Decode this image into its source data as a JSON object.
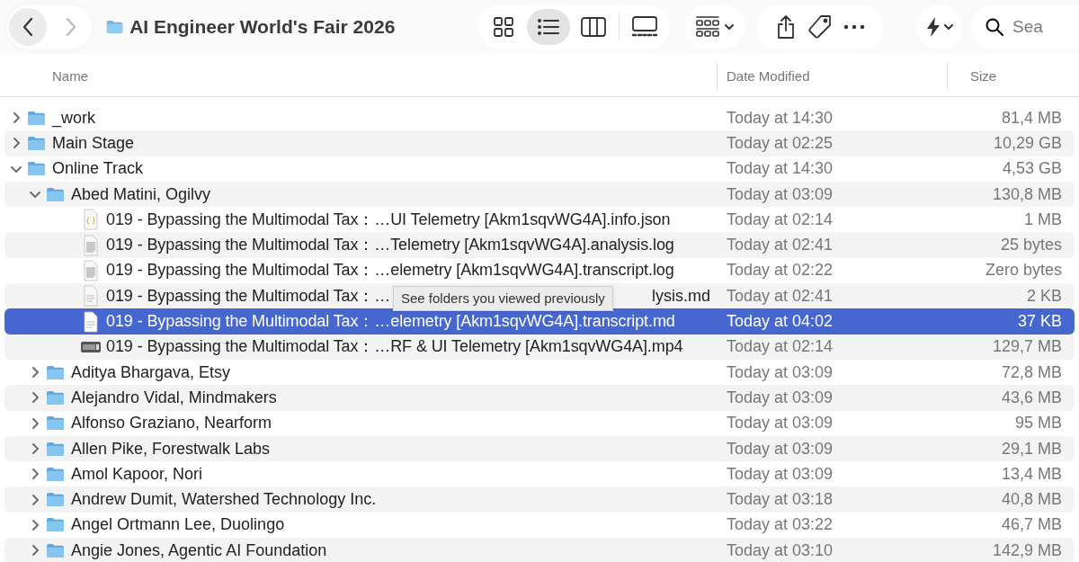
{
  "toolbar": {
    "title": "AI Engineer World's Fair 2026",
    "back_disabled": false,
    "forward_disabled": true,
    "views": [
      {
        "kind": "icons",
        "selected": false
      },
      {
        "kind": "list",
        "selected": true
      },
      {
        "kind": "columns",
        "selected": false
      },
      {
        "kind": "gallery",
        "selected": false
      }
    ],
    "search": {
      "placeholder": "Sea"
    }
  },
  "columns": [
    "Name",
    "Date Modified",
    "Size"
  ],
  "rows": [
    {
      "kind": "folder",
      "name": "_work",
      "date": "Today at 14:30",
      "size": "81,4 MB",
      "expanded": false,
      "selected": false
    },
    {
      "kind": "folder",
      "name": "Main Stage",
      "date": "Today at 02:25",
      "size": "10,29 GB",
      "expanded": false,
      "selected": false
    },
    {
      "kind": "folder",
      "name": "Online Track",
      "date": "Today at 14:30",
      "size": "4,53 GB",
      "expanded": true,
      "selected": false,
      "children": [
        {
          "kind": "folder",
          "name": "Abed Matini, Ogilvy",
          "date": "Today at 03:09",
          "size": "130,8 MB",
          "expanded": true,
          "selected": false,
          "children": [
            {
              "kind": "code",
              "name": "019 - Bypassing the Multimodal Tax：…UI Telemetry [Akm1sqvWG4A].info.json",
              "date": "Today at 02:14",
              "size": "1 MB",
              "selected": false
            },
            {
              "kind": "text",
              "name": "019 - Bypassing the Multimodal Tax：…Telemetry [Akm1sqvWG4A].analysis.log",
              "date": "Today at 02:41",
              "size": "25 bytes",
              "selected": false
            },
            {
              "kind": "text",
              "name": "019 - Bypassing the Multimodal Tax：…elemetry [Akm1sqvWG4A].transcript.log",
              "date": "Today at 02:22",
              "size": "Zero bytes",
              "selected": false
            },
            {
              "kind": "note",
              "name": "019 - Bypassing the Multimodal Tax：…",
              "name_tail": "lysis.md",
              "tooltip": "See folders you viewed previously",
              "date": "Today at 02:41",
              "size": "2 KB",
              "selected": false
            },
            {
              "kind": "note",
              "name": "019 - Bypassing the Multimodal Tax：…elemetry [Akm1sqvWG4A].transcript.md",
              "date": "Today at 04:02",
              "size": "37 KB",
              "selected": true
            },
            {
              "kind": "video",
              "name": "019 - Bypassing the Multimodal Tax：…RF & UI Telemetry [Akm1sqvWG4A].mp4",
              "date": "Today at 02:14",
              "size": "129,7 MB",
              "selected": false
            }
          ]
        },
        {
          "kind": "folder",
          "name": "Aditya Bhargava, Etsy",
          "date": "Today at 03:09",
          "size": "72,8 MB",
          "expanded": false,
          "selected": false
        },
        {
          "kind": "folder",
          "name": "Alejandro Vidal, Mindmakers",
          "date": "Today at 03:09",
          "size": "43,6 MB",
          "expanded": false,
          "selected": false
        },
        {
          "kind": "folder",
          "name": "Alfonso Graziano, Nearform",
          "date": "Today at 03:09",
          "size": "95 MB",
          "expanded": false,
          "selected": false
        },
        {
          "kind": "folder",
          "name": "Allen Pike, Forestwalk Labs",
          "date": "Today at 03:09",
          "size": "29,1 MB",
          "expanded": false,
          "selected": false
        },
        {
          "kind": "folder",
          "name": "Amol Kapoor, Nori",
          "date": "Today at 03:09",
          "size": "13,4 MB",
          "expanded": false,
          "selected": false
        },
        {
          "kind": "folder",
          "name": "Andrew Dumit, Watershed Technology Inc.",
          "date": "Today at 03:18",
          "size": "40,8 MB",
          "expanded": false,
          "selected": false
        },
        {
          "kind": "folder",
          "name": "Angel Ortmann Lee, Duolingo",
          "date": "Today at 03:22",
          "size": "46,7 MB",
          "expanded": false,
          "selected": false
        },
        {
          "kind": "folder",
          "name": "Angie Jones, Agentic AI Foundation",
          "date": "Today at 03:10",
          "size": "142,9 MB",
          "expanded": false,
          "selected": false
        }
      ]
    }
  ]
}
